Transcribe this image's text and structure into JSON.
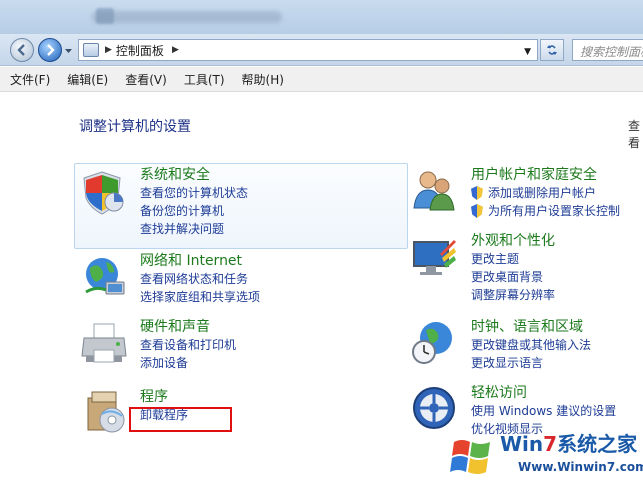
{
  "address_bar": {
    "path": "控制面板",
    "search_placeholder": "搜索控制面板"
  },
  "menu": [
    "文件(F)",
    "编辑(E)",
    "查看(V)",
    "工具(T)",
    "帮助(H)"
  ],
  "page": {
    "title": "调整计算机的设置",
    "view_by_truncated": "查看"
  },
  "categories": [
    {
      "title": "系统和安全",
      "icon": "shield-icon",
      "links": [
        "查看您的计算机状态",
        "备份您的计算机",
        "查找并解决问题"
      ]
    },
    {
      "title": "网络和 Internet",
      "icon": "network-globe-icon",
      "links": [
        "查看网络状态和任务",
        "选择家庭组和共享选项"
      ]
    },
    {
      "title": "硬件和声音",
      "icon": "printer-icon",
      "links": [
        "查看设备和打印机",
        "添加设备"
      ]
    },
    {
      "title": "程序",
      "icon": "programs-icon",
      "links": [
        "卸载程序"
      ]
    },
    {
      "title": "用户帐户和家庭安全",
      "icon": "users-icon",
      "links": [
        "添加或删除用户帐户",
        "为所有用户设置家长控制"
      ]
    },
    {
      "title": "外观和个性化",
      "icon": "display-icon",
      "links": [
        "更改主题",
        "更改桌面背景",
        "调整屏幕分辨率"
      ]
    },
    {
      "title": "时钟、语言和区域",
      "icon": "clock-globe-icon",
      "links": [
        "更改键盘或其他输入法",
        "更改显示语言"
      ]
    },
    {
      "title": "轻松访问",
      "icon": "ease-of-access-icon",
      "links": [
        "使用 Windows 建议的设置",
        "优化视频显示"
      ]
    }
  ],
  "watermark": {
    "brand_prefix": "Win",
    "brand_seven": "7",
    "brand_suffix": "系统之家",
    "url": "Www.Winwin7.com"
  }
}
